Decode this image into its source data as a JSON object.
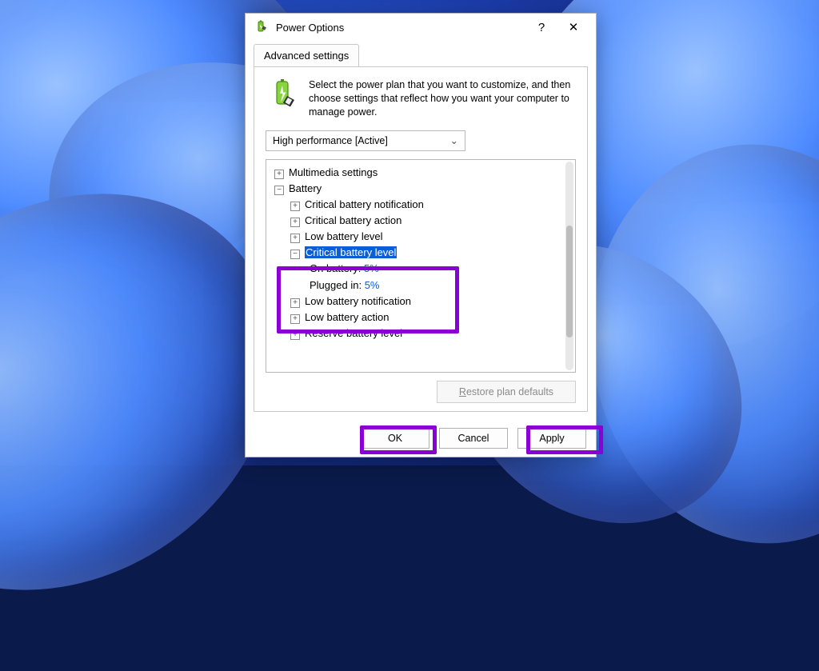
{
  "window": {
    "title": "Power Options",
    "help": "?",
    "close": "✕"
  },
  "tab": {
    "label": "Advanced settings"
  },
  "intro": "Select the power plan that you want to customize, and then choose settings that reflect how you want your computer to manage power.",
  "plan_dropdown": {
    "selected": "High performance [Active]"
  },
  "tree": {
    "multimedia": "Multimedia settings",
    "battery": "Battery",
    "crit_notification": "Critical battery notification",
    "crit_action": "Critical battery action",
    "low_level": "Low battery level",
    "crit_level": "Critical battery level",
    "on_battery_label": "On battery:",
    "on_battery_value": "5%",
    "plugged_in_label": "Plugged in:",
    "plugged_in_value": "5%",
    "low_notification": "Low battery notification",
    "low_action": "Low battery action",
    "reserve_level": "Reserve battery level"
  },
  "restore_label_pre": "R",
  "restore_label_post": "estore plan defaults",
  "buttons": {
    "ok": "OK",
    "cancel": "Cancel",
    "apply": "Apply"
  }
}
